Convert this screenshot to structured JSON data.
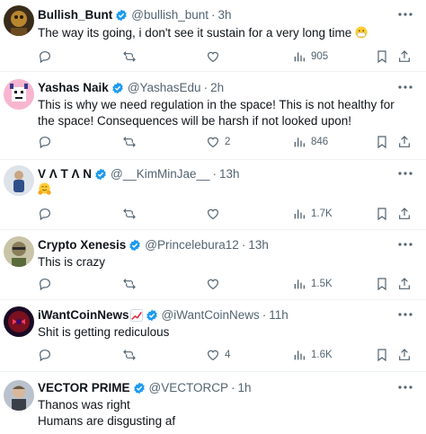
{
  "tweets": [
    {
      "name": "Bullish_Bunt",
      "handle": "@bullish_bunt",
      "dot": "·",
      "time": "3h",
      "text": "The way its going, i don't see it sustain for a very long time",
      "emoji": "mask-face",
      "replies": "",
      "retweets": "",
      "likes": "",
      "views": "905"
    },
    {
      "name": "Yashas Naik",
      "handle": "@YashasEdu",
      "dot": "·",
      "time": "2h",
      "text": "This is why we need regulation in the space! This is not healthy for the space! Consequences will be harsh if not looked upon!",
      "replies": "",
      "retweets": "",
      "likes": "2",
      "views": "846"
    },
    {
      "name": "V Λ T Λ N",
      "handle": "@__KimMinJae__",
      "dot": "·",
      "time": "13h",
      "text": "",
      "emoji": "hugging-face",
      "replies": "",
      "retweets": "",
      "likes": "",
      "views": "1.7K"
    },
    {
      "name": "Crypto Xenesis",
      "handle": "@Princelebura12",
      "dot": "·",
      "time": "13h",
      "text": "This is crazy",
      "replies": "",
      "retweets": "",
      "likes": "",
      "views": "1.5K"
    },
    {
      "name": "iWantCoinNews",
      "name_emoji": "chart-increasing",
      "handle": "@iWantCoinNews",
      "dot": "·",
      "time": "11h",
      "text": "Shit is getting rediculous",
      "replies": "",
      "retweets": "",
      "likes": "4",
      "views": "1.6K"
    },
    {
      "name": "VECTOR PRIME",
      "handle": "@VECTORCP",
      "dot": "·",
      "time": "1h",
      "text": "Thanos was right\nHumans are disgusting af"
    }
  ],
  "colors": {
    "verified": "#1d9bf0",
    "muted": "#536471",
    "divider": "#eff3f4",
    "text": "#0f1419"
  }
}
